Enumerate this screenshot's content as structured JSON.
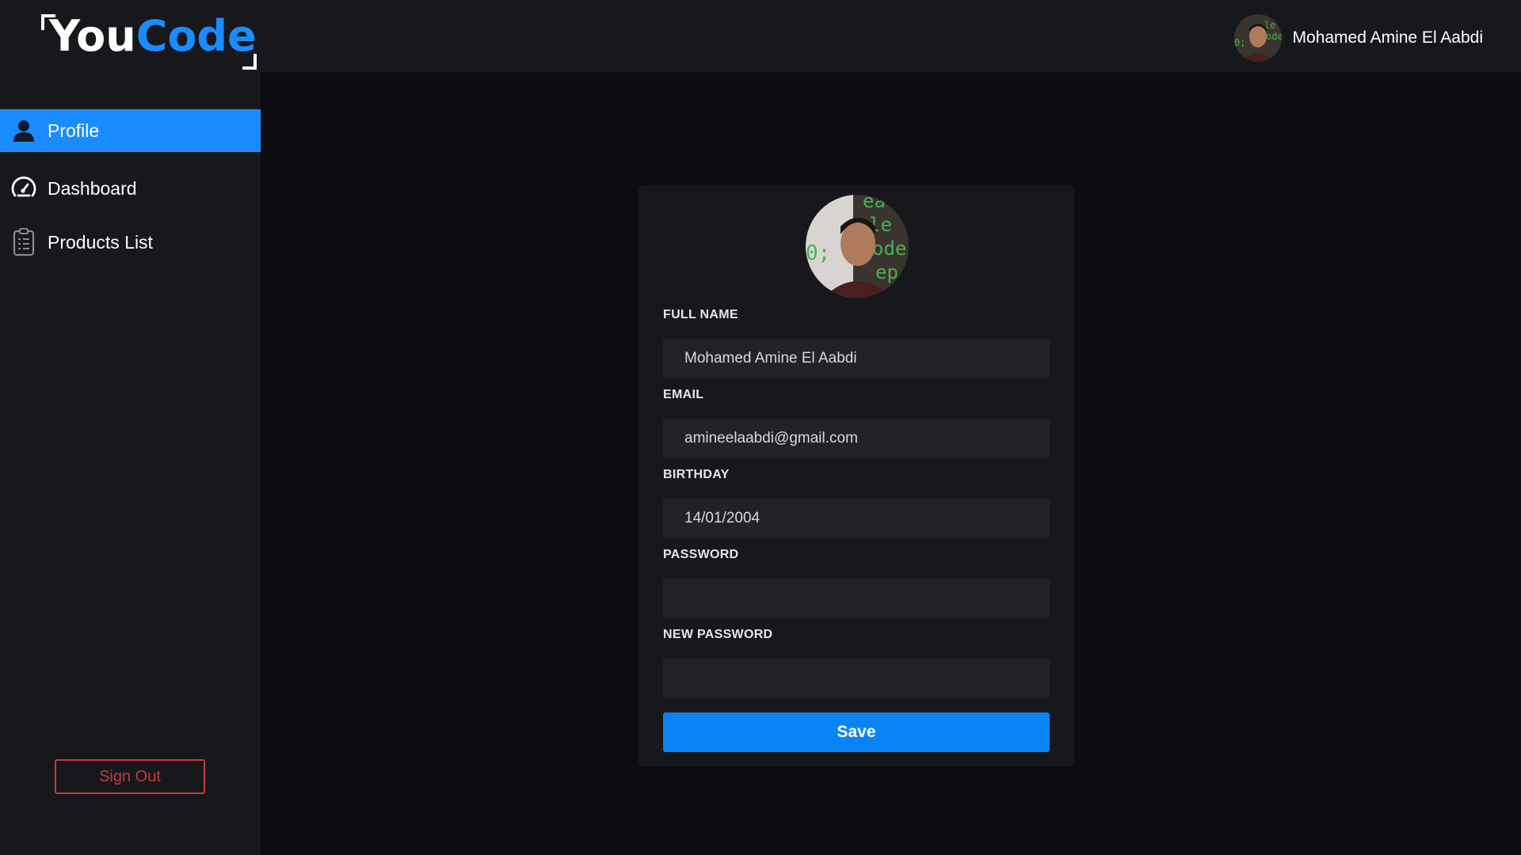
{
  "brand": {
    "part1": "You",
    "part2": "Code"
  },
  "header": {
    "user_name": "Mohamed Amine El Aabdi",
    "avatar_icon": "user-photo"
  },
  "sidebar": {
    "items": [
      {
        "label": "Profile",
        "icon": "user-icon",
        "active": true
      },
      {
        "label": "Dashboard",
        "icon": "speedometer-icon",
        "active": false
      },
      {
        "label": "Products List",
        "icon": "clipboard-list-icon",
        "active": false
      }
    ],
    "sign_out": "Sign Out"
  },
  "profile": {
    "fields": [
      {
        "label": "FULL NAME",
        "value": "Mohamed Amine El Aabdi"
      },
      {
        "label": "EMAIL",
        "value": "amineelaabdi@gmail.com"
      },
      {
        "label": "BIRTHDAY",
        "value": "14/01/2004"
      },
      {
        "label": "PASSWORD",
        "value": ""
      },
      {
        "label": "NEW PASSWORD",
        "value": ""
      }
    ],
    "save_label": "Save"
  },
  "colors": {
    "accent": "#1a8cff",
    "danger": "#c73a3a",
    "panel": "#17181c",
    "background": "#0c0d10"
  }
}
